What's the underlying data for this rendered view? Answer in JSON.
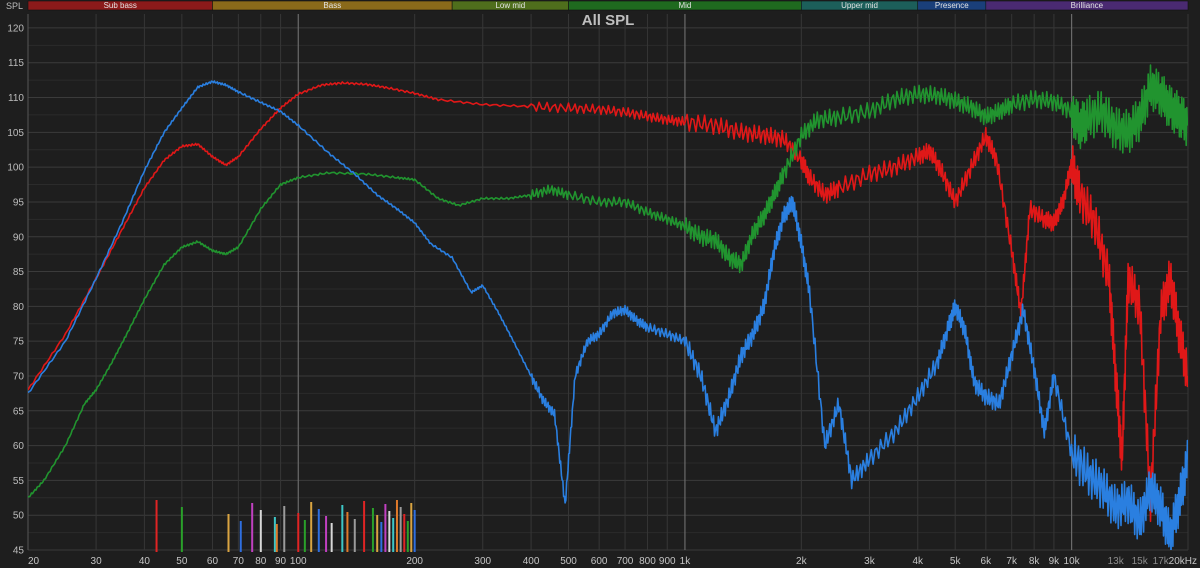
{
  "chart_data": {
    "type": "line",
    "title": "All SPL",
    "ylabel": "SPL",
    "xlabel": "",
    "x_scale": "log",
    "xlim": [
      20,
      20000
    ],
    "ylim": [
      45,
      122
    ],
    "grid": true,
    "y_ticks": [
      45,
      50,
      55,
      60,
      65,
      70,
      75,
      80,
      85,
      90,
      95,
      100,
      105,
      110,
      115,
      120
    ],
    "x_ticks": [
      {
        "value": 20,
        "label": "20"
      },
      {
        "value": 30,
        "label": "30"
      },
      {
        "value": 40,
        "label": "40"
      },
      {
        "value": 50,
        "label": "50"
      },
      {
        "value": 60,
        "label": "60"
      },
      {
        "value": 70,
        "label": "70"
      },
      {
        "value": 80,
        "label": "80"
      },
      {
        "value": 90,
        "label": "90"
      },
      {
        "value": 100,
        "label": "100"
      },
      {
        "value": 200,
        "label": "200"
      },
      {
        "value": 300,
        "label": "300"
      },
      {
        "value": 400,
        "label": "400"
      },
      {
        "value": 500,
        "label": "500"
      },
      {
        "value": 600,
        "label": "600"
      },
      {
        "value": 700,
        "label": "700"
      },
      {
        "value": 800,
        "label": "800"
      },
      {
        "value": 900,
        "label": "900"
      },
      {
        "value": 1000,
        "label": "1k"
      },
      {
        "value": 2000,
        "label": "2k"
      },
      {
        "value": 3000,
        "label": "3k"
      },
      {
        "value": 4000,
        "label": "4k"
      },
      {
        "value": 5000,
        "label": "5k"
      },
      {
        "value": 6000,
        "label": "6k"
      },
      {
        "value": 7000,
        "label": "7k"
      },
      {
        "value": 8000,
        "label": "8k"
      },
      {
        "value": 9000,
        "label": "9k"
      },
      {
        "value": 10000,
        "label": "10k"
      },
      {
        "value": 13000,
        "label": "13k"
      },
      {
        "value": 15000,
        "label": "15k"
      },
      {
        "value": 17000,
        "label": "17k"
      },
      {
        "value": 20000,
        "label": "20kHz"
      }
    ],
    "bands": [
      {
        "name": "Sub bass",
        "from": 20,
        "to": 60,
        "color": "#8b1a1a"
      },
      {
        "name": "Bass",
        "from": 60,
        "to": 250,
        "color": "#8a6a1a"
      },
      {
        "name": "Low mid",
        "from": 250,
        "to": 500,
        "color": "#4f6e1c"
      },
      {
        "name": "Mid",
        "from": 500,
        "to": 2000,
        "color": "#1f6a1f"
      },
      {
        "name": "Upper mid",
        "from": 2000,
        "to": 4000,
        "color": "#1c5f5a"
      },
      {
        "name": "Presence",
        "from": 4000,
        "to": 6000,
        "color": "#1a3f7a"
      },
      {
        "name": "Brilliance",
        "from": 6000,
        "to": 20000,
        "color": "#4a2a72"
      }
    ],
    "series": [
      {
        "color": "#e01818",
        "points": [
          [
            20,
            68
          ],
          [
            25,
            76
          ],
          [
            30,
            84
          ],
          [
            35,
            91
          ],
          [
            40,
            97
          ],
          [
            45,
            101
          ],
          [
            50,
            103
          ],
          [
            55,
            103.3
          ],
          [
            60,
            101.5
          ],
          [
            65,
            100.3
          ],
          [
            70,
            101.5
          ],
          [
            80,
            105.5
          ],
          [
            90,
            108.5
          ],
          [
            100,
            110.5
          ],
          [
            115,
            111.8
          ],
          [
            130,
            112.1
          ],
          [
            150,
            111.9
          ],
          [
            170,
            111.4
          ],
          [
            200,
            110.6
          ],
          [
            230,
            109.7
          ],
          [
            300,
            109
          ],
          [
            400,
            108.7
          ],
          [
            500,
            108.5
          ],
          [
            600,
            108.3
          ],
          [
            700,
            107.9
          ],
          [
            800,
            107.3
          ],
          [
            900,
            106.8
          ],
          [
            1000,
            106.5
          ],
          [
            1200,
            106
          ],
          [
            1400,
            105
          ],
          [
            1600,
            104.6
          ],
          [
            1800,
            104
          ],
          [
            2000,
            101
          ],
          [
            2100,
            98.5
          ],
          [
            2300,
            96
          ],
          [
            2500,
            97
          ],
          [
            3000,
            99
          ],
          [
            3500,
            100
          ],
          [
            4000,
            101.5
          ],
          [
            4300,
            102.3
          ],
          [
            4600,
            99.5
          ],
          [
            5000,
            95
          ],
          [
            5500,
            100
          ],
          [
            6000,
            104.5
          ],
          [
            6400,
            101
          ],
          [
            7000,
            88
          ],
          [
            7400,
            79
          ],
          [
            7800,
            94
          ],
          [
            8500,
            92.5
          ],
          [
            9000,
            92
          ],
          [
            9500,
            95
          ],
          [
            10000,
            100.5
          ],
          [
            10500,
            96
          ],
          [
            11500,
            92
          ],
          [
            12500,
            84
          ],
          [
            13000,
            70
          ],
          [
            13500,
            58
          ],
          [
            14000,
            84
          ],
          [
            15000,
            80
          ],
          [
            16000,
            52
          ],
          [
            17000,
            79
          ],
          [
            18000,
            84
          ],
          [
            19000,
            76
          ],
          [
            20000,
            70
          ]
        ]
      },
      {
        "color": "#21942f",
        "points": [
          [
            20,
            52.5
          ],
          [
            22,
            55
          ],
          [
            25,
            60
          ],
          [
            28,
            66
          ],
          [
            30,
            68
          ],
          [
            33,
            72
          ],
          [
            36,
            76
          ],
          [
            40,
            81
          ],
          [
            45,
            86
          ],
          [
            50,
            88.5
          ],
          [
            55,
            89.3
          ],
          [
            60,
            88
          ],
          [
            65,
            87.5
          ],
          [
            70,
            88.5
          ],
          [
            80,
            94
          ],
          [
            90,
            97.5
          ],
          [
            100,
            98.5
          ],
          [
            120,
            99.2
          ],
          [
            150,
            99
          ],
          [
            180,
            98.5
          ],
          [
            200,
            98.2
          ],
          [
            230,
            95.5
          ],
          [
            260,
            94.5
          ],
          [
            300,
            95.5
          ],
          [
            350,
            95.5
          ],
          [
            400,
            96
          ],
          [
            450,
            96.8
          ],
          [
            500,
            96
          ],
          [
            600,
            95
          ],
          [
            700,
            95
          ],
          [
            800,
            93.5
          ],
          [
            900,
            92.5
          ],
          [
            1000,
            91.5
          ],
          [
            1100,
            90
          ],
          [
            1200,
            89.5
          ],
          [
            1300,
            87
          ],
          [
            1400,
            86
          ],
          [
            1500,
            90.5
          ],
          [
            1600,
            93
          ],
          [
            1700,
            96
          ],
          [
            1800,
            99
          ],
          [
            2000,
            104.5
          ],
          [
            2200,
            106.8
          ],
          [
            2500,
            107.2
          ],
          [
            3000,
            108
          ],
          [
            3500,
            109.8
          ],
          [
            4000,
            110.5
          ],
          [
            4500,
            110.3
          ],
          [
            5000,
            109.5
          ],
          [
            5500,
            108.6
          ],
          [
            6000,
            107.2
          ],
          [
            6500,
            108
          ],
          [
            7000,
            109
          ],
          [
            8000,
            109.8
          ],
          [
            9000,
            109.4
          ],
          [
            10000,
            108
          ],
          [
            10500,
            105.8
          ],
          [
            11000,
            107
          ],
          [
            12000,
            108
          ],
          [
            13000,
            105.5
          ],
          [
            14000,
            105
          ],
          [
            15000,
            107
          ],
          [
            16000,
            111.5
          ],
          [
            17000,
            110.5
          ],
          [
            18000,
            108.5
          ],
          [
            19000,
            107.5
          ],
          [
            20000,
            106
          ]
        ]
      },
      {
        "color": "#2a7fe0",
        "points": [
          [
            20,
            67.5
          ],
          [
            25,
            75
          ],
          [
            30,
            84
          ],
          [
            35,
            92
          ],
          [
            40,
            99.5
          ],
          [
            45,
            105
          ],
          [
            50,
            108.5
          ],
          [
            55,
            111.5
          ],
          [
            60,
            112.3
          ],
          [
            65,
            111.8
          ],
          [
            70,
            110.8
          ],
          [
            80,
            109.3
          ],
          [
            90,
            108
          ],
          [
            100,
            106
          ],
          [
            120,
            102
          ],
          [
            140,
            99
          ],
          [
            160,
            96
          ],
          [
            180,
            94
          ],
          [
            200,
            92
          ],
          [
            220,
            89
          ],
          [
            250,
            87
          ],
          [
            280,
            82
          ],
          [
            300,
            83
          ],
          [
            330,
            79
          ],
          [
            360,
            75
          ],
          [
            400,
            70
          ],
          [
            430,
            66.5
          ],
          [
            460,
            64.5
          ],
          [
            490,
            51.5
          ],
          [
            520,
            70
          ],
          [
            560,
            75
          ],
          [
            600,
            76
          ],
          [
            650,
            79
          ],
          [
            700,
            79.5
          ],
          [
            750,
            78
          ],
          [
            800,
            77
          ],
          [
            900,
            76
          ],
          [
            1000,
            75
          ],
          [
            1100,
            70
          ],
          [
            1200,
            62
          ],
          [
            1300,
            67
          ],
          [
            1400,
            73
          ],
          [
            1500,
            76
          ],
          [
            1600,
            80
          ],
          [
            1700,
            88
          ],
          [
            1800,
            93
          ],
          [
            1900,
            95
          ],
          [
            2000,
            89
          ],
          [
            2100,
            82
          ],
          [
            2300,
            60
          ],
          [
            2500,
            66
          ],
          [
            2700,
            55
          ],
          [
            3000,
            58
          ],
          [
            3500,
            62
          ],
          [
            4000,
            67
          ],
          [
            4500,
            72
          ],
          [
            4800,
            77
          ],
          [
            5000,
            80
          ],
          [
            5300,
            76.5
          ],
          [
            5600,
            69
          ],
          [
            6000,
            67
          ],
          [
            6500,
            66
          ],
          [
            7000,
            73
          ],
          [
            7500,
            79.5
          ],
          [
            8000,
            71
          ],
          [
            8500,
            62
          ],
          [
            9000,
            70
          ],
          [
            10000,
            59
          ],
          [
            11000,
            56
          ],
          [
            12000,
            54
          ],
          [
            13000,
            51
          ],
          [
            14000,
            52
          ],
          [
            15000,
            49
          ],
          [
            16000,
            54
          ],
          [
            17000,
            51
          ],
          [
            18000,
            47
          ],
          [
            19000,
            52
          ],
          [
            20000,
            58
          ]
        ]
      }
    ]
  }
}
